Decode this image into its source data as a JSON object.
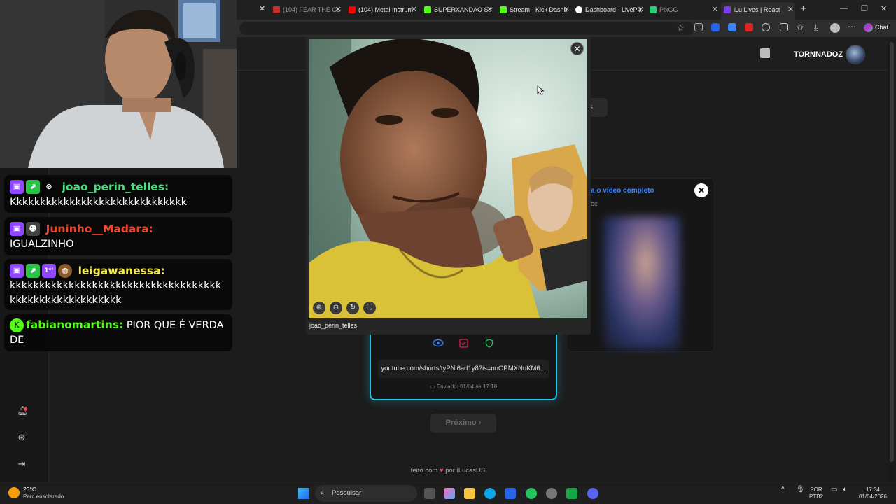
{
  "browser": {
    "tabs": [
      {
        "title": "(104) FEAR THE CL",
        "fav_color": "#c4302b",
        "dim": true
      },
      {
        "title": "(104) Metal Instrum",
        "fav_color": "#ff0000",
        "dim": false
      },
      {
        "title": "SUPERXANDAO Str",
        "fav_color": "#53fc18",
        "dim": false
      },
      {
        "title": "Stream - Kick Dashb",
        "fav_color": "#53fc18",
        "dim": false
      },
      {
        "title": "Dashboard - LivePix",
        "fav_color": "#ffffff",
        "dim": false
      },
      {
        "title": "PixGG",
        "fav_color": "#2ecc71",
        "dim": true
      },
      {
        "title": "iLu Lives | React",
        "fav_color": "#7c3aed",
        "dim": false
      }
    ],
    "chat_button": "Chat"
  },
  "app": {
    "username": "TORNNADOZ",
    "next_button": "Próximo ›",
    "footer_prefix": "feito com",
    "footer_heart": "♥",
    "footer_suffix": "por iLucasUS",
    "bg_button_fragment": "s"
  },
  "video_card": {
    "title_fragment": "a o vídeo completo",
    "subtitle_fragment": "be",
    "close_label": "✕"
  },
  "submission": {
    "url": "youtube.com/shorts/tyPNi6ad1y8?is=nnOPMXNuKM6...",
    "sent": "Enviado: 01/04 às 17:18",
    "icon_colors": {
      "view": "#3b82f6",
      "check": "#e11d48",
      "shield": "#22c55e"
    }
  },
  "modal": {
    "caption": "joao_perin_telles",
    "close_label": "✕",
    "controls": [
      "⊕",
      "⊖",
      "↻",
      "⛶"
    ]
  },
  "chat": [
    {
      "user": "joao_perin_telles:",
      "color": "#4ade80",
      "badges": [
        "twitch",
        "green",
        "eye"
      ],
      "text": "Kkkkkkkkkkkkkkkkkkkkkkkkkkkkkk"
    },
    {
      "user": "Juninho__Madara:",
      "color": "#f0442c",
      "badges": [
        "twitch",
        "mask"
      ],
      "text": "IGUALZINHO"
    },
    {
      "user": "leigawanessa:",
      "color": "#f5e94a",
      "badges": [
        "twitch",
        "green",
        "first",
        "pie"
      ],
      "text": "kkkkkkkkkkkkkkkkkkkkkkkkkkkkkkkkkkkkkkkkkkkkkkkkkkkkkkk"
    },
    {
      "user": "fabianomartins:",
      "color": "#53fc18",
      "badges": [
        "kick"
      ],
      "text": "PIOR QUE É VERDADE"
    }
  ],
  "taskbar": {
    "temp": "23°C",
    "weather": "Parc ensolarado",
    "search": "Pesquisar",
    "lang1": "POR",
    "lang2": "PTB2",
    "time": "17:34",
    "date": "01/04/2026"
  }
}
